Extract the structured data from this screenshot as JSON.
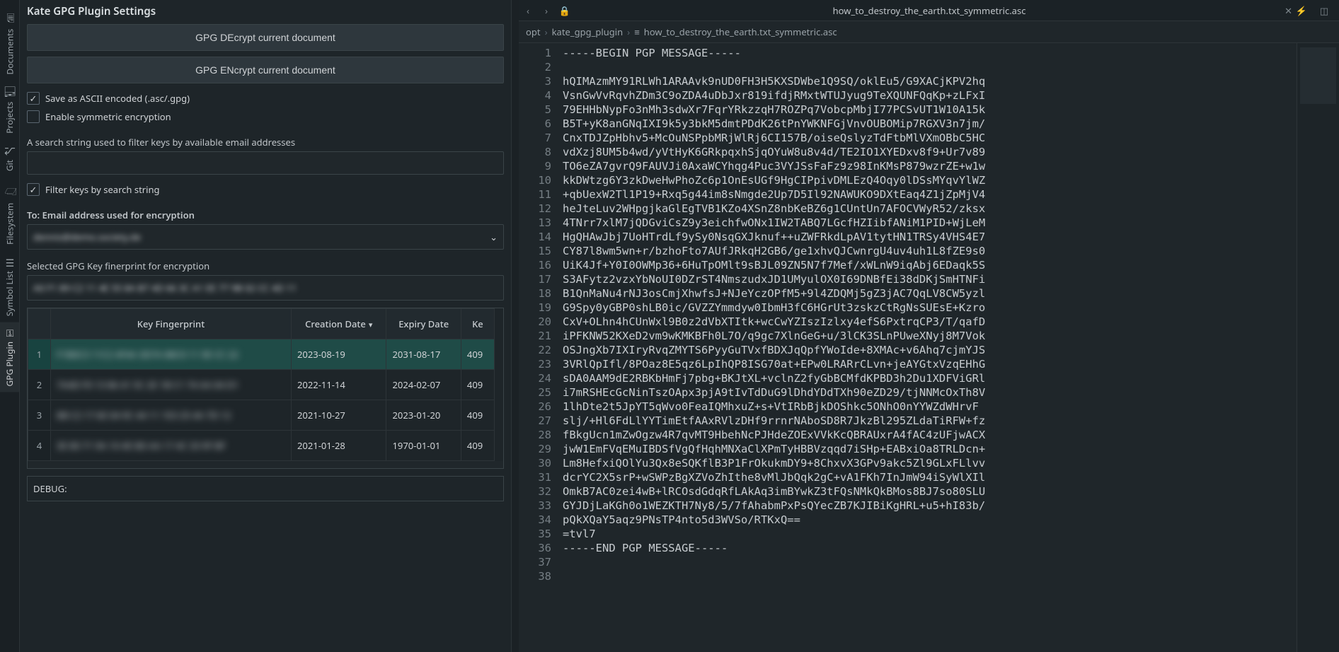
{
  "activity": {
    "items": [
      {
        "label": "Documents",
        "icon": "🗎"
      },
      {
        "label": "Projects",
        "icon": "🗂"
      },
      {
        "label": "Git",
        "icon": "⎇"
      },
      {
        "label": "Filesystem",
        "icon": "🗁"
      },
      {
        "label": "Symbol List",
        "icon": "☰"
      },
      {
        "label": "GPG Plugin",
        "icon": "⚿"
      }
    ],
    "active_index": 5
  },
  "panel": {
    "title": "Kate GPG Plugin Settings",
    "decrypt_btn": "GPG DEcrypt current document",
    "encrypt_btn": "GPG ENcrypt current document",
    "save_ascii": "Save as ASCII encoded (.asc/.gpg)",
    "enable_symmetric": "Enable symmetric encryption",
    "search_help": "A search string used to filter keys by available email addresses",
    "filter_label": "Filter keys by search string",
    "to_label": "To: Email address used for encryption",
    "to_value": "dennis@demo.society.de",
    "fingerprint_label": "Selected GPG Key finerprint for encryption",
    "fingerprint_value": "A0 F1 89 C2 11 4E 55 8A B7 4D 66 3C A1 EE 77 9B 02 CC 4D 11",
    "table": {
      "headers": [
        "",
        "Key Fingerprint",
        "Creation Date",
        "Expiry Date",
        "Ke"
      ],
      "sort_col": 2,
      "rows": [
        {
          "n": "1",
          "fp": "F1B0C3 11C2 4F4A 3D7A 88C0 11 9E CC 22",
          "created": "2023-08-19",
          "expiry": "2031-08-17",
          "keyid": "409",
          "selected": true
        },
        {
          "n": "2",
          "fp": "7A4D F0 13 86 41 5C 2E 1B C1 74 AA 04 D1",
          "created": "2022-11-14",
          "expiry": "2024-02-07",
          "keyid": "409",
          "selected": false
        },
        {
          "n": "3",
          "fp": "8B C2 17 6E 04 9C 44 11 1E3 25 4A 7D 12",
          "created": "2021-10-27",
          "expiry": "2023-01-20",
          "keyid": "409",
          "selected": false
        },
        {
          "n": "4",
          "fp": "3E 80 71 9A 10 4E 8D AA 17 4C 33 9F BF",
          "created": "2021-01-28",
          "expiry": "1970-01-01",
          "keyid": "409",
          "selected": false
        }
      ]
    },
    "debug_label": "DEBUG:"
  },
  "editor": {
    "filename": "how_to_destroy_the_earth.txt_symmetric.asc",
    "breadcrumb": [
      "opt",
      "kate_gpg_plugin",
      "how_to_destroy_the_earth.txt_symmetric.asc"
    ],
    "code_lines": [
      "-----BEGIN PGP MESSAGE-----",
      "",
      "hQIMAzmMY91RLWh1ARAAvk9nUD0FH3H5KXSDWbe1Q9SQ/oklEu5/G9XACjKPV2hq",
      "VsnGwVvRqvhZDm3C9oZDA4uDbJxr819ifdjRMxtWTUJyug9TeXQUNFQqKp+zLFxI",
      "79EHHbNypFo3nMh3sdwXr7FqrYRkzzqH7ROZPq7VobcpMbjI77PCSvUT1W10A15k",
      "B5T+yK8anGNqIXI9k5y3bkM5dmtPDdK26tPnYWKNFGjVnvOUBOMip7RGXV3n7jm/",
      "CnxTDJZpHbhv5+McOuNSPpbMRjWlRj6CI157B/oiseQslyzTdFtbMlVXmOBbC5HC",
      "vdXzj8UM5b4wd/yVtHyK6GRkpqxhSjqOYuW8u8v4d/TE2IO1XYEDxv8f9+Ur7v89",
      "TO6eZA7gvrQ9FAUVJi0AxaWCYhqg4Puc3VYJSsFaFz9z98InKMsP879wzrZE+w1w",
      "kkDWtzg6Y3zkDweHwPhoZc6p1OnEsUGf9HgCIPpivDMLEzQ4Oqy0lDSsMYqvYlWZ",
      "+qbUexW2Tl1P19+Rxq5g44im8sNmgde2Up7D5Il92NAWUKO9DXtEaq4Z1jZpMjV4",
      "heJteLuv2WHpgjkaGlEgTVB1KZo4XSnZ8nbKeBZ6g1CUntUn7AFOCVWyR52/zksx",
      "4TNrr7xlM7jQDGviCsZ9y3eichfwONx1IW2TABQ7LGcfHZIibfANiM1PID+WjLeM",
      "HgQHAwJbj7UoHTrdLf9ySy0NsqGXJknuf++uZWFRkdLpAV1tytHN1TRSy4VHS4E7",
      "CY87l8wm5wn+r/bzhoFto7AUfJRkqH2GB6/ge1xhvQJCwnrgU4uv4uh1L8fZE9s0",
      "UiK4Jf+Y0I0OWMp36+6HuTpOMlt9sBJL09ZN5N7f7Mef/xWLnW9iqAbj6EDaqk5S",
      "S3AFytz2vzxYbNoUI0DZrST4NmszudxJD1UMyulOX0I69DNBfEi38dDKjSmHTNFi",
      "B1QnMaNu4rNJ3osCmjXhwfsJ+NJeYczOPfM5+9l4ZDQMj5gZ3jAC7QqLV8CW5yzl",
      "G9Spy0yGBP0shLB0ic/GVZZYmmdyw0IbmH3fC6HGrUt3zskzCtRgNsSUEsE+Kzro",
      "CxV+OLhn4hCUnWxl9B0z2dVbXTItk+wcCwYZIszIzlxy4efS6PxtrqCP3/T/qafD",
      "iPFKNW52KXeD2vm9wKMKBFh0L7O/q9gc7XlnGeG+u/3lCK3SLnPUweXNyj8M7Vok",
      "OSJngXb7IXIryRvqZMYTS6PyyGuTVxfBDXJqQpfYWoIde+8XMAc+v6Ahq7cjmYJS",
      "3VRlQpIfl/8POaz8E5qz6LpIhQP8ISG70at+EPw0LRARrCLvn+jeAYGtxVzqEHhG",
      "sDA0AAM9dE2RBKbHmFj7pbg+BKJtXL+vclnZ2fyGbBCMfdKPBD3h2Du1XDFViGRl",
      "i7mRSHEcGcNinTszOApx3pjA9tIvTdDuG9lDhdYDdTXh90eZD29/tjNNMcOxTh8V",
      "1lhDte2t5JpYT5qWvo0FeaIQMhxuZ+s+VtIRbBjkDOShkc5ONhO0nYYWZdWHrvF",
      "slj/+Hl6FdLlYYTimEtfAAxRVlzDHf9rrnrNAboSD8R7JkzBl295ZLdaTiRFW+fz",
      "fBkgUcn1mZwOgzw4R7qvMT9HbehNcPJHdeZOExVVkKcQBRAUxrA4fAC4zUFjwACX",
      "jwW1EmFVqEMuIBDSfVgQfHqhMNXaClXPmTyHBBVzqqd7iSHp+EABxiOa8TRLDcn+",
      "Lm8HefxiQOlYu3Qx8eSQKflB3P1FrOkukmDY9+8ChxvX3GPv9akc5Zl9GLxFLlvv",
      "dcrYC2X5srP+wSWPzBgXZVoZhIthe8vMlJbQqk2gC+vA1FKh7InJmW94iSyWlXIl",
      "OmkB7AC0zei4wB+lRCOsdGdqRfLAkAq3imBYwkZ3tFQsNMkQkBMos8BJ7so80SLU",
      "GYJDjLaKGh0o1WEZKTH7Ny8/5/7fAhabmPxPsQYecZB7KJIBiKgHRL+u5+hI83b/",
      "pQkXQaY5aqz9PNsTP4nto5d3WVSo/RTKxQ==",
      "=tvl7",
      "-----END PGP MESSAGE-----"
    ]
  }
}
